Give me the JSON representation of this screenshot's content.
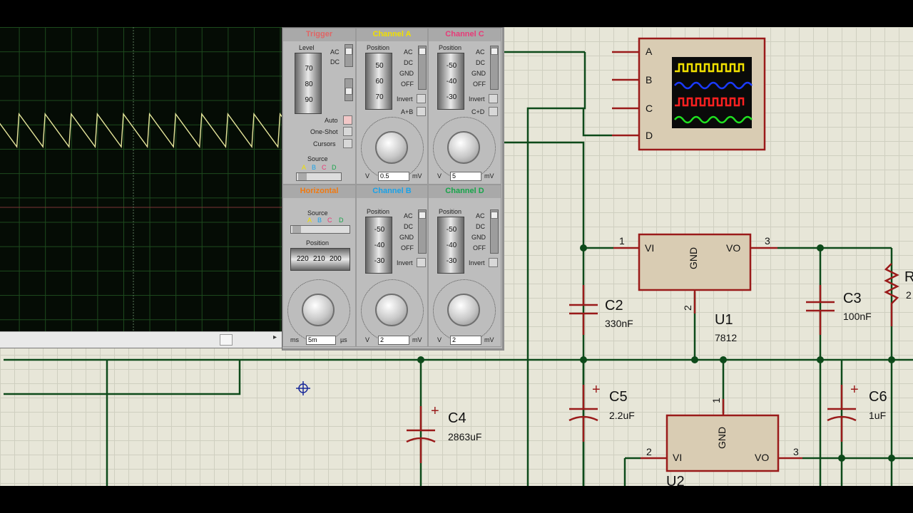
{
  "oscilloscope": {
    "trigger": {
      "title": "Trigger",
      "level_label": "Level",
      "level_ticks": [
        "70",
        "80",
        "90"
      ],
      "ac": "AC",
      "dc": "DC",
      "modes": [
        "Auto",
        "One-Shot",
        "Cursors"
      ],
      "source_label": "Source",
      "sources": [
        "A",
        "B",
        "C",
        "D"
      ]
    },
    "channel_a": {
      "title": "Channel A",
      "position_label": "Position",
      "position_ticks": [
        "50",
        "60",
        "70"
      ],
      "coupling": [
        "AC",
        "DC",
        "GND",
        "OFF"
      ],
      "invert": "Invert",
      "combine": "A+B",
      "dial_value": "0.5",
      "unit_left": "V",
      "unit_right": "mV"
    },
    "channel_c": {
      "title": "Channel C",
      "position_label": "Position",
      "position_ticks": [
        "-50",
        "-40",
        "-30"
      ],
      "coupling": [
        "AC",
        "DC",
        "GND",
        "OFF"
      ],
      "invert": "Invert",
      "combine": "C+D",
      "dial_value": "5",
      "unit_left": "V",
      "unit_right": "mV"
    },
    "horizontal": {
      "title": "Horizontal",
      "source_label": "Source",
      "sources": [
        "A",
        "B",
        "C",
        "D"
      ],
      "position_label": "Position",
      "position_ticks": [
        "220",
        "210",
        "200"
      ],
      "dial_value": "5m",
      "unit_left": "ms",
      "unit_right": "µs"
    },
    "channel_b": {
      "title": "Channel B",
      "position_label": "Position",
      "position_ticks": [
        "-50",
        "-40",
        "-30"
      ],
      "coupling": [
        "AC",
        "DC",
        "GND",
        "OFF"
      ],
      "invert": "Invert",
      "dial_value": "2",
      "unit_left": "V",
      "unit_right": "mV"
    },
    "channel_d": {
      "title": "Channel D",
      "position_label": "Position",
      "position_ticks": [
        "-50",
        "-40",
        "-30"
      ],
      "coupling": [
        "AC",
        "DC",
        "GND",
        "OFF"
      ],
      "invert": "Invert",
      "dial_value": "2",
      "unit_left": "V",
      "unit_right": "mV"
    },
    "dial_scale": [
      "0.1",
      "0.2",
      "0.5",
      "1",
      "2",
      "5",
      "10",
      "20",
      "0.5",
      "1",
      "2",
      "5",
      "10",
      "20",
      "50",
      "100",
      "200"
    ]
  },
  "schematic": {
    "scope_symbol": {
      "pins": [
        "A",
        "B",
        "C",
        "D"
      ]
    },
    "u1": {
      "ref": "U1",
      "value": "7812",
      "pin_vi": "VI",
      "pin_vo": "VO",
      "pin_gnd": "GND",
      "pin1": "1",
      "pin2": "2",
      "pin3": "3"
    },
    "u2": {
      "ref": "U2",
      "pin_vi": "VI",
      "pin_vo": "VO",
      "pin_gnd": "GND",
      "pin1": "1",
      "pin2": "2",
      "pin3": "3"
    },
    "c2": {
      "ref": "C2",
      "value": "330nF"
    },
    "c3": {
      "ref": "C3",
      "value": "100nF"
    },
    "c4": {
      "ref": "C4",
      "value": "2863uF"
    },
    "c5": {
      "ref": "C5",
      "value": "2.2uF"
    },
    "c6": {
      "ref": "C6",
      "value": "1uF"
    },
    "r_partial": {
      "ref": "R",
      "value": "2"
    },
    "plus_sign": "+"
  },
  "colors": {
    "wire": "#0d4a1a",
    "component": "#9a1a1a",
    "body_fill": "#d9ccb3",
    "trace": "#e5e59a",
    "channel_a": "#f0e000",
    "channel_b": "#1aa2e8",
    "channel_c": "#e83a78",
    "channel_d": "#17a54a",
    "horizontal": "#f07a12",
    "trigger": "#e06666"
  }
}
